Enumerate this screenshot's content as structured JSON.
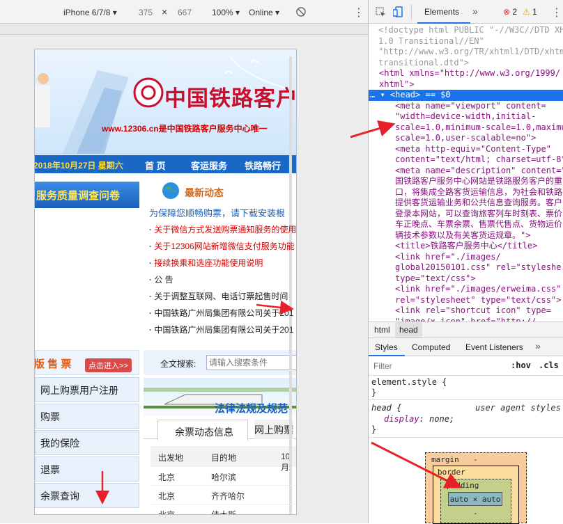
{
  "device_toolbar": {
    "device": "iPhone 6/7/8",
    "width": "375",
    "times": "×",
    "height": "667",
    "zoom": "100%",
    "network": "Online"
  },
  "devtools": {
    "tabs": [
      "Elements"
    ],
    "errors": "2",
    "warnings": "1",
    "source_lines": [
      {
        "t": "cm",
        "text": "<!doctype html PUBLIC \"-//W3C//DTD XH"
      },
      {
        "t": "cm",
        "text": "1.0 Transitional//EN\""
      },
      {
        "t": "cm",
        "text": "\"http://www.w3.org/TR/xhtml1/DTD/xhtm"
      },
      {
        "t": "cm",
        "text": "transitional.dtd\">"
      },
      {
        "t": "html",
        "text": "<html xmlns=\"http://www.w3.org/1999/"
      },
      {
        "t": "html",
        "text": "xhtml\">"
      },
      {
        "t": "sel",
        "text": "… ▾ <head> == $0"
      },
      {
        "t": "m",
        "text": "<meta name=\"viewport\" content="
      },
      {
        "t": "m",
        "text": "\"width=device-width,initial-"
      },
      {
        "t": "m",
        "text": "scale=1.0,minimum-scale=1.0,maximu"
      },
      {
        "t": "m",
        "text": "scale=1.0,user-scalable=no\">"
      },
      {
        "t": "m",
        "text": "<meta http-equiv=\"Content-Type\""
      },
      {
        "t": "m",
        "text": "content=\"text/html; charset=utf-8\""
      },
      {
        "t": "m",
        "text": "<meta name=\"description\" content=\""
      },
      {
        "t": "m",
        "text": "国铁路客户服务中心网站是铁路服务客户的重"
      },
      {
        "t": "m",
        "text": "口，将集成全路客货运输信息，为社会和铁路"
      },
      {
        "t": "m",
        "text": "提供客货运输业务和公共信息查询服务。客户"
      },
      {
        "t": "m",
        "text": "登录本网站，可以查询旅客列车时刻表、票价"
      },
      {
        "t": "m",
        "text": "车正晚点、车票余票、售票代售点、货物运价"
      },
      {
        "t": "m",
        "text": "辆技术参数以及有关客货运规章。\">"
      },
      {
        "t": "m",
        "text": "<title>铁路客户服务中心</title>"
      },
      {
        "t": "m",
        "text": "<link href=\"./images/"
      },
      {
        "t": "m",
        "text": "global20150101.css\" rel=\"styleshe"
      },
      {
        "t": "m",
        "text": "type=\"text/css\">"
      },
      {
        "t": "m",
        "text": "<link href=\"./images/erweima.css\""
      },
      {
        "t": "m",
        "text": "rel=\"stylesheet\" type=\"text/css\">"
      },
      {
        "t": "m",
        "text": "<link rel=\"shortcut icon\" type="
      },
      {
        "t": "m",
        "text": "\"image/x-icon\" href=\"http://"
      }
    ],
    "breadcrumbs": [
      "html",
      "head"
    ],
    "style_tabs": [
      "Styles",
      "Computed",
      "Event Listeners"
    ],
    "filter_placeholder": "Filter",
    "hov": ":hov",
    "cls": ".cls",
    "element_style": "element.style {",
    "close_brace": "}",
    "rule_selector": "head {",
    "rule_origin": "user agent styles",
    "rule_prop": "display",
    "rule_val": "none;",
    "box": {
      "margin": "margin",
      "margin_dash": "-",
      "border": "border",
      "padding": "padding",
      "content": "auto × auto",
      "bottom_dash": "-"
    }
  },
  "page": {
    "logo_text": "中国铁路客户",
    "url_line": "www.12306.cn是中国铁路客户服务中心唯一",
    "date": "2018年10月27日 星期六",
    "nav": [
      "首 页",
      "客运服务",
      "铁路畅行"
    ],
    "survey": "服务质量调查问卷",
    "news_title": "最新动态",
    "news_headline": "为保障您顺畅购票，请下载安装根",
    "news": [
      {
        "text": "关于微信方式发送购票通知服务的使用",
        "color": "red"
      },
      {
        "text": "关于12306网站新增微信支付服务功能",
        "color": "red"
      },
      {
        "text": "接续换乘和选座功能使用说明",
        "color": "red"
      },
      {
        "text": "公 告",
        "color": "black"
      },
      {
        "text": "关于调整互联网、电话订票起售时间",
        "color": "black"
      },
      {
        "text": "中国铁路广州局集团有限公司关于201",
        "color": "black"
      },
      {
        "text": "中国铁路广州局集团有限公司关于201",
        "color": "black"
      }
    ],
    "ticket_title": "版 售 票",
    "enter": "点击进入>>",
    "search_label": "全文搜索:",
    "search_placeholder": "请输入搜索条件",
    "law_text": "法律法规及规范",
    "side_menu": [
      "网上购票用户注册",
      "购票",
      "我的保险",
      "退票",
      "余票查询"
    ],
    "tabs": [
      "余票动态信息",
      "网上购票"
    ],
    "table_headers": [
      "出发地",
      "目的地",
      "10月"
    ],
    "table_rows": [
      [
        "北京",
        "哈尔滨"
      ],
      [
        "北京",
        "齐齐哈尔"
      ],
      [
        "北京",
        "佳木斯"
      ]
    ]
  },
  "colors": {
    "accent": "#1a73e8",
    "nav": "#1b67c6",
    "red": "#d40000",
    "arrow": "#e8202a"
  }
}
